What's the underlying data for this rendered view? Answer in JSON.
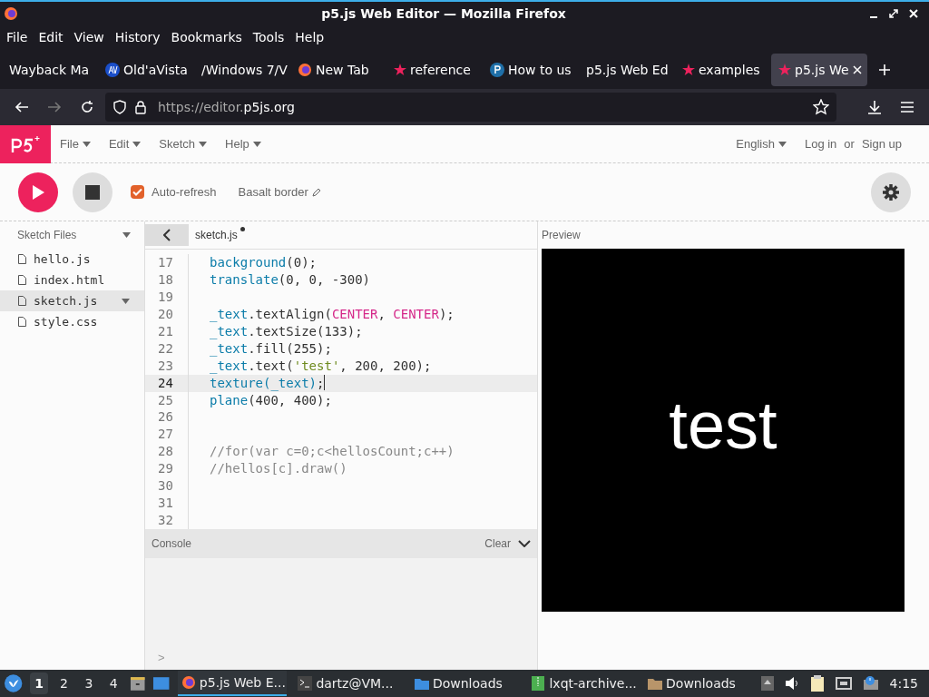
{
  "window": {
    "title": "p5.js Web Editor — Mozilla Firefox"
  },
  "menubar": [
    "File",
    "Edit",
    "View",
    "History",
    "Bookmarks",
    "Tools",
    "Help"
  ],
  "tabs": [
    {
      "label": "Wayback Ma",
      "kind": "plain",
      "selected": false
    },
    {
      "label": "Old'aVista",
      "kind": "globe",
      "selected": false
    },
    {
      "label": "/Windows 7/V",
      "kind": "plain",
      "selected": false
    },
    {
      "label": "New Tab",
      "kind": "firefox",
      "selected": false
    },
    {
      "label": "reference",
      "kind": "star",
      "selected": false
    },
    {
      "label": "How to us",
      "kind": "letter",
      "selected": false
    },
    {
      "label": "p5.js Web Ed",
      "kind": "plain",
      "selected": false
    },
    {
      "label": "examples",
      "kind": "star",
      "selected": false
    },
    {
      "label": "p5.js We",
      "kind": "star",
      "selected": true
    }
  ],
  "address": {
    "prefix": "https://editor.",
    "domain": "p5js.org"
  },
  "app_menu": [
    "File",
    "Edit",
    "Sketch",
    "Help"
  ],
  "account": {
    "language": "English",
    "login": "Log in",
    "or": "or",
    "signup": "Sign up"
  },
  "toolbar": {
    "auto_refresh": {
      "label": "Auto-refresh",
      "checked": true
    },
    "sketch_name": "Basalt border"
  },
  "sidebar": {
    "title": "Sketch Files",
    "files": [
      {
        "name": "hello.js",
        "selected": false
      },
      {
        "name": "index.html",
        "selected": false
      },
      {
        "name": "sketch.js",
        "selected": true
      },
      {
        "name": "style.css",
        "selected": false
      }
    ]
  },
  "editor": {
    "file_tab": "sketch.js",
    "unsaved": true,
    "lines": [
      {
        "number": "17",
        "current": false,
        "tokens": [
          {
            "kind": "fn",
            "text": "background"
          },
          {
            "kind": "plain",
            "text": "(0);"
          }
        ]
      },
      {
        "number": "18",
        "current": false,
        "tokens": [
          {
            "kind": "fn",
            "text": "translate"
          },
          {
            "kind": "plain",
            "text": "(0, 0, -300)"
          }
        ]
      },
      {
        "number": "19",
        "current": false
      },
      {
        "number": "20",
        "current": false,
        "tokens": [
          {
            "kind": "fn",
            "text": "_text"
          },
          {
            "kind": "plain",
            "text": ".textAlign("
          },
          {
            "kind": "const",
            "text": "CENTER"
          },
          {
            "kind": "plain",
            "text": ", "
          },
          {
            "kind": "const",
            "text": "CENTER"
          },
          {
            "kind": "plain",
            "text": ");"
          }
        ]
      },
      {
        "number": "21",
        "current": false,
        "tokens": [
          {
            "kind": "fn",
            "text": "_text"
          },
          {
            "kind": "plain",
            "text": ".textSize(133);"
          }
        ]
      },
      {
        "number": "22",
        "current": false,
        "tokens": [
          {
            "kind": "fn",
            "text": "_text"
          },
          {
            "kind": "plain",
            "text": ".fill(255);"
          }
        ]
      },
      {
        "number": "23",
        "current": false,
        "tokens": [
          {
            "kind": "fn",
            "text": "_text"
          },
          {
            "kind": "plain",
            "text": ".text("
          },
          {
            "kind": "string",
            "text": "'test'"
          },
          {
            "kind": "plain",
            "text": ", 200, 200);"
          }
        ]
      },
      {
        "number": "24",
        "current": true,
        "tokens": [
          {
            "kind": "fn",
            "text": "texture(_text)"
          },
          {
            "kind": "plain",
            "text": ";"
          }
        ]
      },
      {
        "number": "25",
        "current": false,
        "tokens": [
          {
            "kind": "fn",
            "text": "plane"
          },
          {
            "kind": "plain",
            "text": "(400, 400);"
          }
        ]
      },
      {
        "number": "26",
        "current": false
      },
      {
        "number": "27",
        "current": false
      },
      {
        "number": "28",
        "current": false,
        "tokens": [
          {
            "kind": "comment",
            "text": "//for(var c=0;c<hellosCount;c++)"
          }
        ]
      },
      {
        "number": "29",
        "current": false,
        "tokens": [
          {
            "kind": "comment",
            "text": "//hellos[c].draw()"
          }
        ]
      },
      {
        "number": "30",
        "current": false
      },
      {
        "number": "31",
        "current": false
      },
      {
        "number": "32",
        "current": false
      }
    ]
  },
  "console": {
    "title": "Console",
    "clear": "Clear",
    "prompt": ">"
  },
  "preview": {
    "title": "Preview",
    "canvas_text": "test"
  },
  "taskbar": {
    "workspaces": [
      {
        "label": "1",
        "selected": true
      },
      {
        "label": "2",
        "selected": false
      },
      {
        "label": "3",
        "selected": false
      },
      {
        "label": "4",
        "selected": false
      }
    ],
    "windows": [
      {
        "label": "p5.js Web E...",
        "kind": "browser",
        "selected": true
      },
      {
        "label": "dartz@VM...",
        "kind": "terminal",
        "selected": false
      },
      {
        "label": "Downloads",
        "kind": "files",
        "selected": false
      },
      {
        "label": "lxqt-archive...",
        "kind": "archiver",
        "selected": false
      },
      {
        "label": "Downloads",
        "kind": "dialog",
        "selected": false
      }
    ],
    "clock": "4:15"
  }
}
